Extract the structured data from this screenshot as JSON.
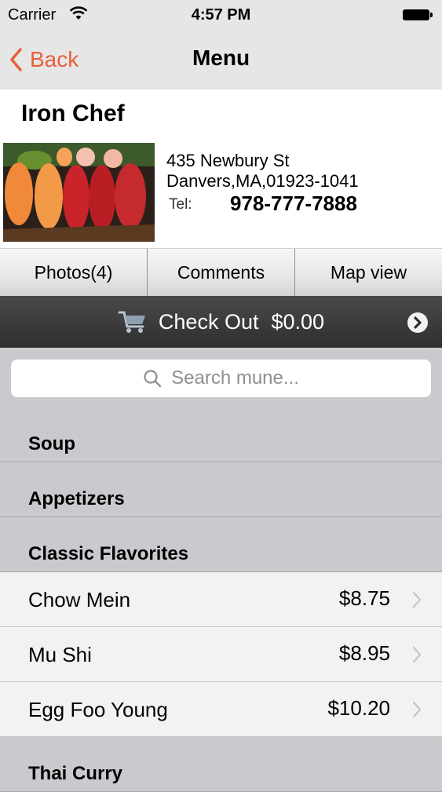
{
  "status_bar": {
    "carrier": "Carrier",
    "time": "4:57 PM"
  },
  "nav": {
    "back_label": "Back",
    "title": "Menu"
  },
  "restaurant": {
    "name": "Iron Chef",
    "address_line1": "435 Newbury St",
    "address_line2": "Danvers,MA,01923-1041",
    "tel_label": "Tel:",
    "phone": "978-777-7888"
  },
  "tabs": [
    {
      "label": "Photos(4)"
    },
    {
      "label": "Comments"
    },
    {
      "label": "Map view"
    }
  ],
  "checkout": {
    "label": "Check Out",
    "total": "$0.00"
  },
  "search": {
    "placeholder": "Search mune..."
  },
  "menu": {
    "sections": [
      {
        "title": "Soup",
        "items": []
      },
      {
        "title": "Appetizers",
        "items": []
      },
      {
        "title": "Classic Flavorites",
        "items": [
          {
            "name": "Chow Mein",
            "price": "$8.75"
          },
          {
            "name": "Mu Shi",
            "price": "$8.95"
          },
          {
            "name": "Egg Foo Young",
            "price": "$10.20"
          }
        ]
      },
      {
        "title": "Thai Curry",
        "items": []
      }
    ]
  },
  "colors": {
    "accent": "#e8603a",
    "checkout_bg": "#3a3a3a",
    "list_bg": "#c9c9ce"
  }
}
